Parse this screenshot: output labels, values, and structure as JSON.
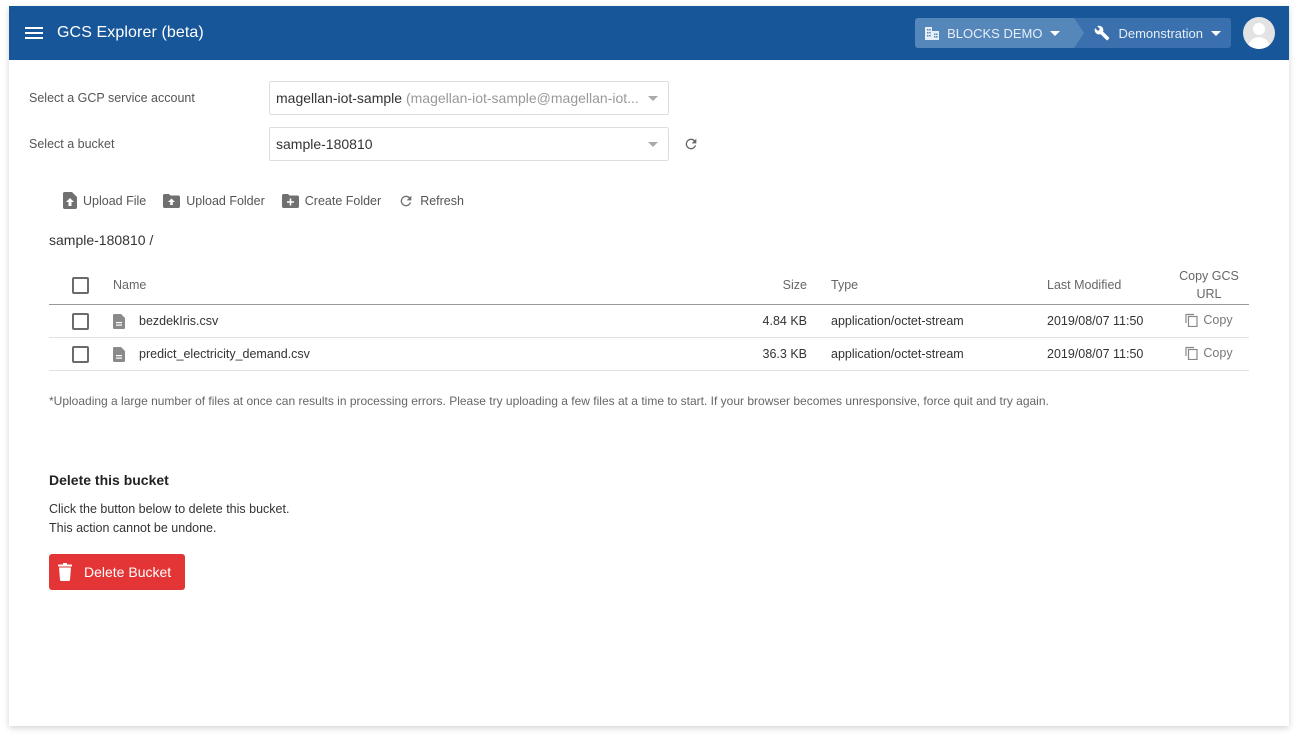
{
  "header": {
    "title": "GCS Explorer (beta)",
    "org_label": "BLOCKS DEMO",
    "project_label": "Demonstration",
    "brand_color": "#18569a"
  },
  "form": {
    "service_account_label": "Select a GCP service account",
    "service_account_value": "magellan-iot-sample",
    "service_account_detail": "(magellan-iot-sample@magellan-iot...",
    "bucket_label": "Select a bucket",
    "bucket_value": "sample-180810"
  },
  "toolbar": {
    "upload_file": "Upload File",
    "upload_folder": "Upload Folder",
    "create_folder": "Create Folder",
    "refresh": "Refresh"
  },
  "path": "sample-180810 /",
  "table": {
    "headers": {
      "name": "Name",
      "size": "Size",
      "type": "Type",
      "modified": "Last Modified",
      "copy": "Copy GCS URL"
    },
    "rows": [
      {
        "name": "bezdekIris.csv",
        "size": "4.84 KB",
        "type": "application/octet-stream",
        "modified": "2019/08/07 11:50",
        "copy": "Copy"
      },
      {
        "name": "predict_electricity_demand.csv",
        "size": "36.3 KB",
        "type": "application/octet-stream",
        "modified": "2019/08/07 11:50",
        "copy": "Copy"
      }
    ]
  },
  "note": "*Uploading a large number of files at once can results in processing errors. Please try uploading a few files at a time to start. If your browser becomes unresponsive, force quit and try again.",
  "delete_section": {
    "title": "Delete this bucket",
    "line1": "Click the button below to delete this bucket.",
    "line2": "This action cannot be undone.",
    "button": "Delete Bucket",
    "button_color": "#e33535"
  }
}
